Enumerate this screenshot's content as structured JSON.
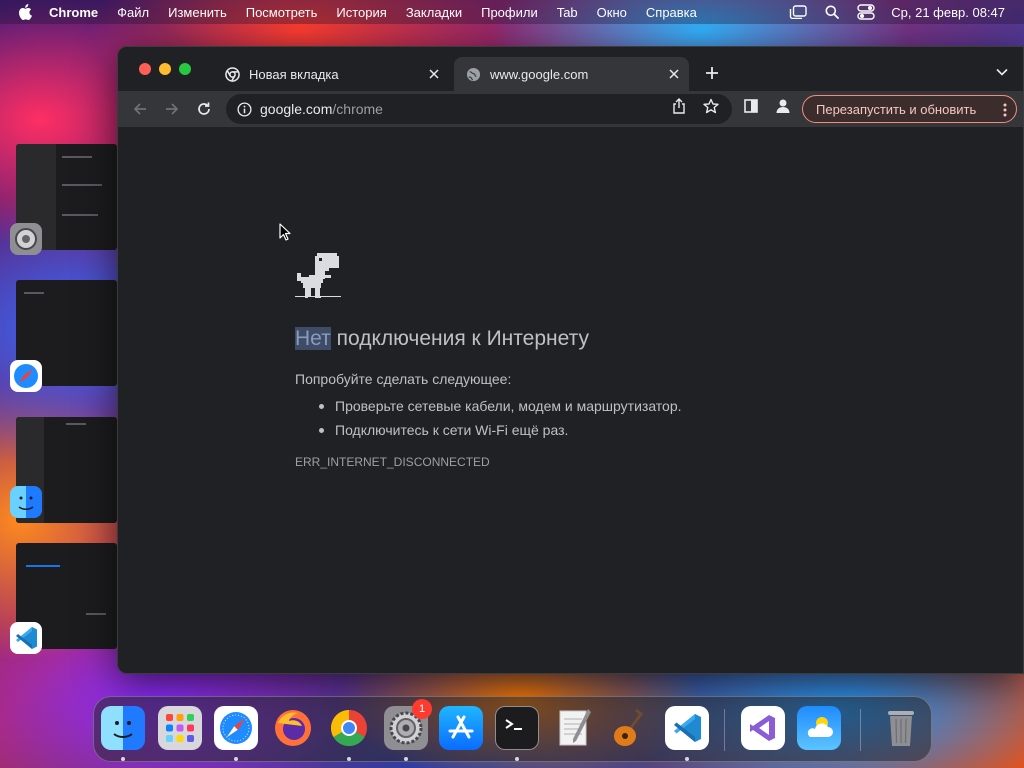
{
  "menubar": {
    "items": [
      "Chrome",
      "Файл",
      "Изменить",
      "Посмотреть",
      "История",
      "Закладки",
      "Профили",
      "Tab",
      "Окно",
      "Справка"
    ],
    "datetime": "Ср, 21 февр.  08:47"
  },
  "browser": {
    "tabs": [
      {
        "title": "Новая вкладка",
        "icon": "chrome-icon",
        "active": false
      },
      {
        "title": "www.google.com",
        "icon": "globe-icon",
        "active": true
      }
    ],
    "url_host": "google.com",
    "url_path": "/chrome",
    "update_button": "Перезапустить и обновить"
  },
  "error_page": {
    "title_highlighted": "Нет",
    "title_rest": " подключения к Интернету",
    "suggestion_intro": "Попробуйте сделать следующее:",
    "suggestions": [
      "Проверьте сетевые кабели, модем и маршрутизатор.",
      "Подключитесь к сети Wi-Fi ещё раз."
    ],
    "error_code": "ERR_INTERNET_DISCONNECTED"
  },
  "dock": {
    "apps": [
      "Finder",
      "Launchpad",
      "Safari",
      "Firefox",
      "Chrome",
      "System Settings",
      "App Store",
      "Terminal",
      "TextEdit",
      "GarageBand",
      "Visual Studio Code",
      "Visual Studio",
      "Weather",
      "Trash"
    ],
    "settings_badge": "1"
  },
  "colors": {
    "window_bg": "#202124",
    "toolbar_bg": "#35363a",
    "update_accent": "#f28b82",
    "selection": "#3e4c67"
  }
}
